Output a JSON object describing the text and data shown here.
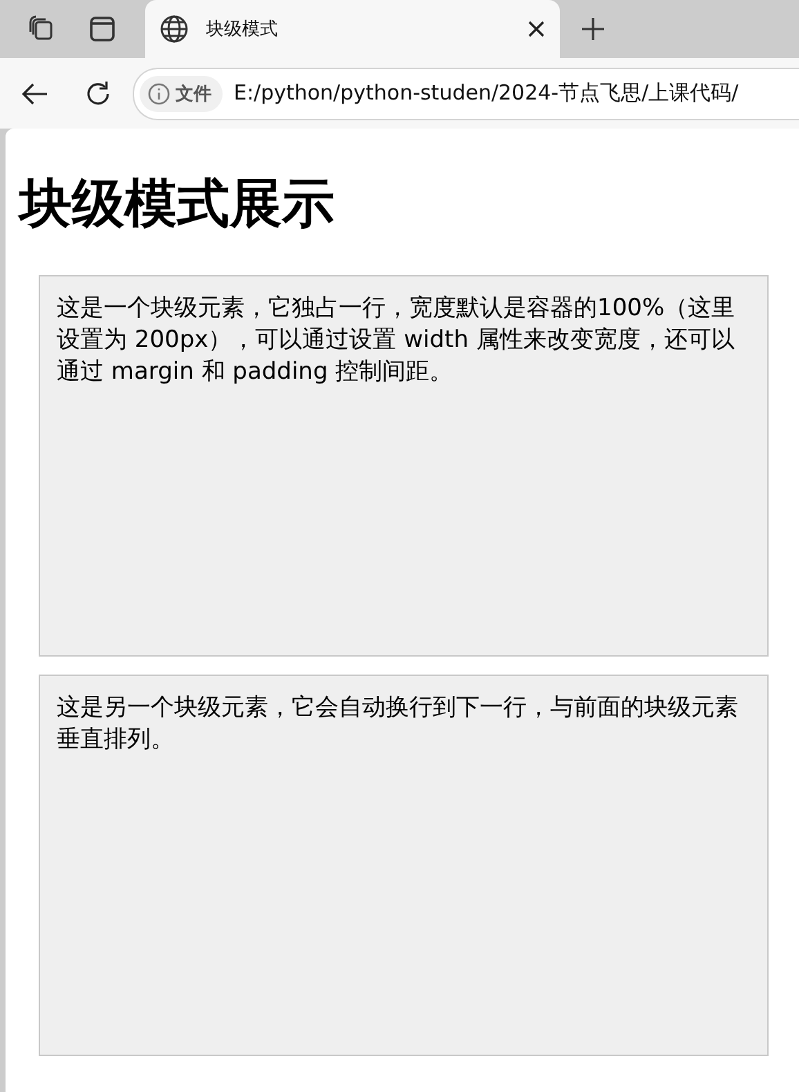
{
  "tab": {
    "title": "块级模式"
  },
  "address_bar": {
    "badge": "文件",
    "url": "E:/python/python-studen/2024-节点飞思/上课代码/"
  },
  "page": {
    "heading": "块级模式展示",
    "blocks": [
      {
        "text": "这是一个块级元素，它独占一行，宽度默认是容器的100%（这里设置为 200px），可以通过设置 width 属性来改变宽度，还可以通过 margin 和 padding 控制间距。"
      },
      {
        "text": "这是另一个块级元素，它会自动换行到下一行，与前面的块级元素垂直排列。"
      }
    ]
  }
}
